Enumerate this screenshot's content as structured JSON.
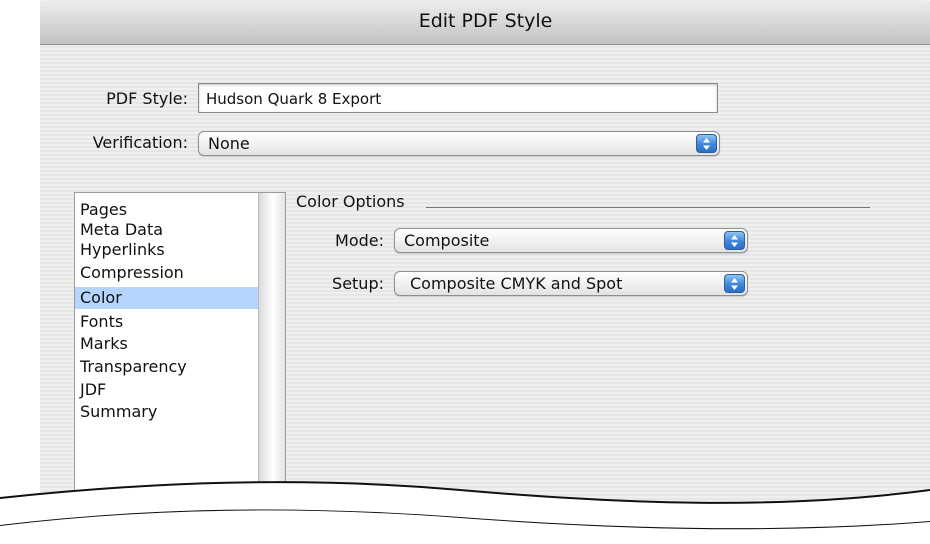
{
  "window": {
    "title": "Edit PDF Style"
  },
  "form": {
    "pdf_style_label": "PDF Style:",
    "pdf_style_value": "Hudson Quark 8 Export",
    "verification_label": "Verification:",
    "verification_value": "None"
  },
  "sidebar": {
    "items": [
      {
        "label": "Pages"
      },
      {
        "label": "Meta Data"
      },
      {
        "label": "Hyperlinks"
      },
      {
        "label": "Compression"
      },
      {
        "label": "Color",
        "selected": true
      },
      {
        "label": "Fonts"
      },
      {
        "label": "Marks"
      },
      {
        "label": "Transparency"
      },
      {
        "label": "JDF"
      },
      {
        "label": "Summary"
      }
    ]
  },
  "color_options": {
    "group_title": "Color Options",
    "mode_label": "Mode:",
    "mode_value": "Composite",
    "setup_label": "Setup:",
    "setup_value": "Composite CMYK and Spot"
  },
  "colors": {
    "selection": "#b5d5ff",
    "popup_arrow": "#3f86d8"
  }
}
